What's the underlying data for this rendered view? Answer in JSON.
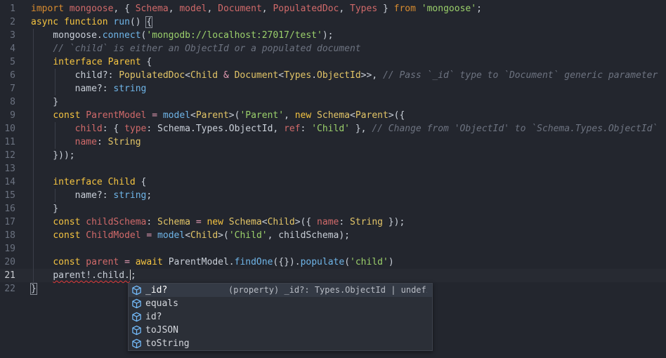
{
  "editor": {
    "lines": [
      {
        "n": "1",
        "tokens": [
          [
            "kw2",
            "import"
          ],
          [
            "pl",
            " "
          ],
          [
            "prop",
            "mongoose"
          ],
          [
            "pl",
            ", { "
          ],
          [
            "prop",
            "Schema"
          ],
          [
            "pl",
            ", "
          ],
          [
            "prop",
            "model"
          ],
          [
            "pl",
            ", "
          ],
          [
            "prop",
            "Document"
          ],
          [
            "pl",
            ", "
          ],
          [
            "prop",
            "PopulatedDoc"
          ],
          [
            "pl",
            ", "
          ],
          [
            "prop",
            "Types"
          ],
          [
            "pl",
            " } "
          ],
          [
            "kw2",
            "from"
          ],
          [
            "pl",
            " "
          ],
          [
            "str",
            "'mongoose'"
          ],
          [
            "pl",
            ";"
          ]
        ]
      },
      {
        "n": "2",
        "tokens": [
          [
            "kw",
            "async"
          ],
          [
            "pl",
            " "
          ],
          [
            "kw",
            "function"
          ],
          [
            "pl",
            " "
          ],
          [
            "fn",
            "run"
          ],
          [
            "pl",
            "() "
          ],
          [
            "box",
            "{"
          ]
        ]
      },
      {
        "n": "3",
        "tokens": [
          [
            "pl",
            "    mongoose."
          ],
          [
            "fn",
            "connect"
          ],
          [
            "pl",
            "("
          ],
          [
            "str",
            "'mongodb://localhost:27017/test'"
          ],
          [
            "pl",
            ");"
          ]
        ]
      },
      {
        "n": "4",
        "tokens": [
          [
            "pl",
            "    "
          ],
          [
            "cm",
            "// `child` is either an ObjectId or a populated document"
          ]
        ]
      },
      {
        "n": "5",
        "tokens": [
          [
            "pl",
            "    "
          ],
          [
            "kw",
            "interface"
          ],
          [
            "pl",
            " "
          ],
          [
            "cls",
            "Parent"
          ],
          [
            "pl",
            " {"
          ]
        ]
      },
      {
        "n": "6",
        "tokens": [
          [
            "pl",
            "        child?: "
          ],
          [
            "ty",
            "PopulatedDoc"
          ],
          [
            "pl",
            "<"
          ],
          [
            "ty",
            "Child"
          ],
          [
            "pl",
            " "
          ],
          [
            "op",
            "&"
          ],
          [
            "pl",
            " "
          ],
          [
            "ty",
            "Document"
          ],
          [
            "pl",
            "<"
          ],
          [
            "ty",
            "Types"
          ],
          [
            "pl",
            "."
          ],
          [
            "ty",
            "ObjectId"
          ],
          [
            "pl",
            ">>, "
          ],
          [
            "cm",
            "// Pass `_id` type to `Document` generic parameter"
          ]
        ]
      },
      {
        "n": "7",
        "tokens": [
          [
            "pl",
            "        name?: "
          ],
          [
            "fn",
            "string"
          ]
        ]
      },
      {
        "n": "8",
        "tokens": [
          [
            "pl",
            "    }"
          ]
        ]
      },
      {
        "n": "9",
        "tokens": [
          [
            "pl",
            "    "
          ],
          [
            "kw",
            "const"
          ],
          [
            "pl",
            " "
          ],
          [
            "prop",
            "ParentModel"
          ],
          [
            "pl",
            " "
          ],
          [
            "op",
            "="
          ],
          [
            "pl",
            " "
          ],
          [
            "fn",
            "model"
          ],
          [
            "pl",
            "<"
          ],
          [
            "ty",
            "Parent"
          ],
          [
            "pl",
            ">("
          ],
          [
            "str",
            "'Parent'"
          ],
          [
            "pl",
            ", "
          ],
          [
            "kw",
            "new"
          ],
          [
            "pl",
            " "
          ],
          [
            "ty",
            "Schema"
          ],
          [
            "pl",
            "<"
          ],
          [
            "ty",
            "Parent"
          ],
          [
            "pl",
            ">({"
          ]
        ]
      },
      {
        "n": "10",
        "tokens": [
          [
            "pl",
            "        "
          ],
          [
            "prop",
            "child"
          ],
          [
            "pl",
            ": { "
          ],
          [
            "prop",
            "type"
          ],
          [
            "pl",
            ": Schema.Types.ObjectId, "
          ],
          [
            "prop",
            "ref"
          ],
          [
            "pl",
            ": "
          ],
          [
            "str",
            "'Child'"
          ],
          [
            "pl",
            " }, "
          ],
          [
            "cm",
            "// Change from 'ObjectId' to `Schema.Types.ObjectId`"
          ]
        ]
      },
      {
        "n": "11",
        "tokens": [
          [
            "pl",
            "        "
          ],
          [
            "prop",
            "name"
          ],
          [
            "pl",
            ": "
          ],
          [
            "ty",
            "String"
          ]
        ]
      },
      {
        "n": "12",
        "tokens": [
          [
            "pl",
            "    }));"
          ]
        ]
      },
      {
        "n": "13",
        "tokens": []
      },
      {
        "n": "14",
        "tokens": [
          [
            "pl",
            "    "
          ],
          [
            "kw",
            "interface"
          ],
          [
            "pl",
            " "
          ],
          [
            "cls",
            "Child"
          ],
          [
            "pl",
            " {"
          ]
        ]
      },
      {
        "n": "15",
        "tokens": [
          [
            "pl",
            "        name?: "
          ],
          [
            "fn",
            "string"
          ],
          [
            "pl",
            ";"
          ]
        ]
      },
      {
        "n": "16",
        "tokens": [
          [
            "pl",
            "    }"
          ]
        ]
      },
      {
        "n": "17",
        "tokens": [
          [
            "pl",
            "    "
          ],
          [
            "kw",
            "const"
          ],
          [
            "pl",
            " "
          ],
          [
            "prop",
            "childSchema"
          ],
          [
            "pl",
            ": "
          ],
          [
            "ty",
            "Schema"
          ],
          [
            "pl",
            " "
          ],
          [
            "op",
            "="
          ],
          [
            "pl",
            " "
          ],
          [
            "kw",
            "new"
          ],
          [
            "pl",
            " "
          ],
          [
            "ty",
            "Schema"
          ],
          [
            "pl",
            "<"
          ],
          [
            "ty",
            "Child"
          ],
          [
            "pl",
            ">({ "
          ],
          [
            "prop",
            "name"
          ],
          [
            "pl",
            ": "
          ],
          [
            "ty",
            "String"
          ],
          [
            "pl",
            " });"
          ]
        ]
      },
      {
        "n": "18",
        "tokens": [
          [
            "pl",
            "    "
          ],
          [
            "kw",
            "const"
          ],
          [
            "pl",
            " "
          ],
          [
            "prop",
            "ChildModel"
          ],
          [
            "pl",
            " "
          ],
          [
            "op",
            "="
          ],
          [
            "pl",
            " "
          ],
          [
            "fn",
            "model"
          ],
          [
            "pl",
            "<"
          ],
          [
            "ty",
            "Child"
          ],
          [
            "pl",
            ">("
          ],
          [
            "str",
            "'Child'"
          ],
          [
            "pl",
            ", childSchema);"
          ]
        ]
      },
      {
        "n": "19",
        "tokens": []
      },
      {
        "n": "20",
        "tokens": [
          [
            "pl",
            "    "
          ],
          [
            "kw",
            "const"
          ],
          [
            "pl",
            " "
          ],
          [
            "prop",
            "parent"
          ],
          [
            "pl",
            " "
          ],
          [
            "op",
            "="
          ],
          [
            "pl",
            " "
          ],
          [
            "kw",
            "await"
          ],
          [
            "pl",
            " ParentModel."
          ],
          [
            "fn",
            "findOne"
          ],
          [
            "pl",
            "({})."
          ],
          [
            "fn",
            "populate"
          ],
          [
            "pl",
            "("
          ],
          [
            "str",
            "'child'"
          ],
          [
            "pl",
            ")"
          ]
        ]
      },
      {
        "n": "21",
        "tokens": [
          [
            "pl",
            "    "
          ],
          [
            "squig",
            "parent!.child."
          ],
          [
            "cursor",
            ""
          ],
          [
            "pl",
            ";"
          ]
        ],
        "current": true
      },
      {
        "n": "22",
        "tokens": [
          [
            "box",
            "}"
          ]
        ]
      }
    ]
  },
  "suggestions": {
    "icon": "symbol-property-icon",
    "icon_color": "#75beff",
    "items": [
      {
        "label": "_id?",
        "detail": "(property) _id?: Types.ObjectId | undefin…",
        "selected": true
      },
      {
        "label": "equals",
        "detail": "",
        "selected": false
      },
      {
        "label": "id?",
        "detail": "",
        "selected": false
      },
      {
        "label": "toJSON",
        "detail": "",
        "selected": false
      },
      {
        "label": "toString",
        "detail": "",
        "selected": false
      }
    ]
  }
}
